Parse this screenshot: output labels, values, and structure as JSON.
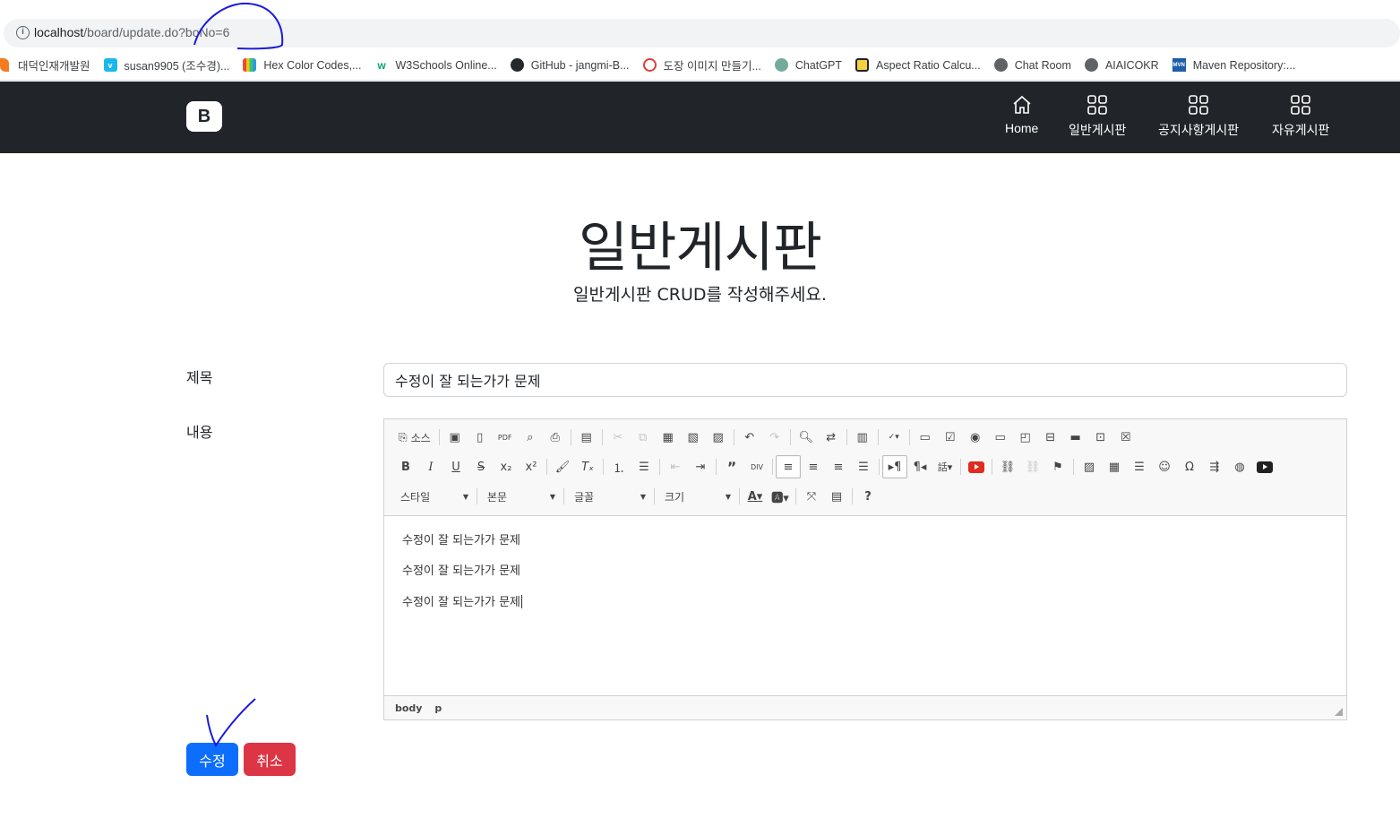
{
  "browser": {
    "url_host": "localhost",
    "url_path": "/board/update.do?boNo=6",
    "bookmarks": [
      {
        "label": "대덕인재개발원",
        "icon": "orange-flame-icon",
        "color": "#f47b20"
      },
      {
        "label": "susan9905 (조수경)...",
        "icon": "v-icon",
        "color": "#1ab7ea"
      },
      {
        "label": "Hex Color Codes,...",
        "icon": "color-book-icon",
        "color": "#8e44ad"
      },
      {
        "label": "W3Schools Online...",
        "icon": "w3-icon",
        "color": "#04aa6d"
      },
      {
        "label": "GitHub - jangmi-B...",
        "icon": "github-icon",
        "color": "#24292e"
      },
      {
        "label": "도장 이미지 만들기...",
        "icon": "stamp-icon",
        "color": "#e03c3c"
      },
      {
        "label": "ChatGPT",
        "icon": "chatgpt-icon",
        "color": "#74aa9c"
      },
      {
        "label": "Aspect Ratio Calcu...",
        "icon": "aspect-icon",
        "color": "#f4d03f"
      },
      {
        "label": "Chat Room",
        "icon": "globe-icon",
        "color": "#5f6368"
      },
      {
        "label": "AIAICOKR",
        "icon": "globe-icon",
        "color": "#5f6368"
      },
      {
        "label": "Maven Repository:...",
        "icon": "mvn-icon",
        "color": "#1d5ea8"
      }
    ]
  },
  "navbar": {
    "brand": "B",
    "items": [
      {
        "label": "Home",
        "icon": "home-icon"
      },
      {
        "label": "일반게시판",
        "icon": "grid-icon"
      },
      {
        "label": "공지사항게시판",
        "icon": "grid-icon"
      },
      {
        "label": "자유게시판",
        "icon": "grid-icon"
      }
    ]
  },
  "header": {
    "title": "일반게시판",
    "subtitle": "일반게시판 CRUD를 작성해주세요."
  },
  "form": {
    "title_label": "제목",
    "title_value": "수정이 잘 되는가가 문제",
    "content_label": "내용",
    "editor": {
      "source_label": "소스",
      "combos": [
        "스타일",
        "본문",
        "글꼴",
        "크기"
      ],
      "paragraphs": [
        "수정이 잘 되는가가 문제",
        "수정이 잘 되는가가 문제",
        "수정이 잘 되는가가 문제"
      ],
      "path": [
        "body",
        "p"
      ]
    },
    "submit_label": "수정",
    "cancel_label": "취소"
  },
  "colors": {
    "navbar_bg": "#212529",
    "primary": "#0d6efd",
    "danger": "#dc3545",
    "annotation": "#1a1adb"
  }
}
